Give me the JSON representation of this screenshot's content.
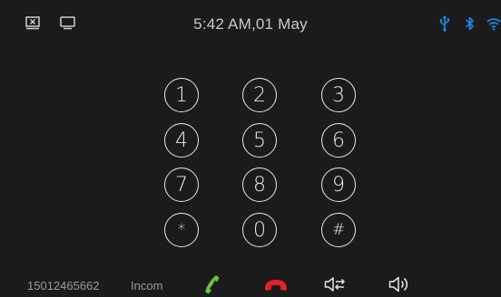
{
  "status_bar": {
    "time_date": "5:42 AM,01 May",
    "icons": [
      "screen-off-icon",
      "window-icon",
      "usb-icon",
      "bluetooth-icon",
      "wifi-icon"
    ],
    "accent_color": "#1e90ff"
  },
  "keypad": {
    "keys": [
      "1",
      "2",
      "3",
      "4",
      "5",
      "6",
      "7",
      "8",
      "9",
      "*",
      "0",
      "#"
    ]
  },
  "bottom_bar": {
    "phone_number": "15012465662",
    "call_status": "Incom",
    "icons": [
      "answer-call-icon",
      "hang-up-icon",
      "audio-switch-icon",
      "speaker-icon"
    ],
    "answer_color": "#6fc23a",
    "hangup_color": "#e8202a"
  }
}
